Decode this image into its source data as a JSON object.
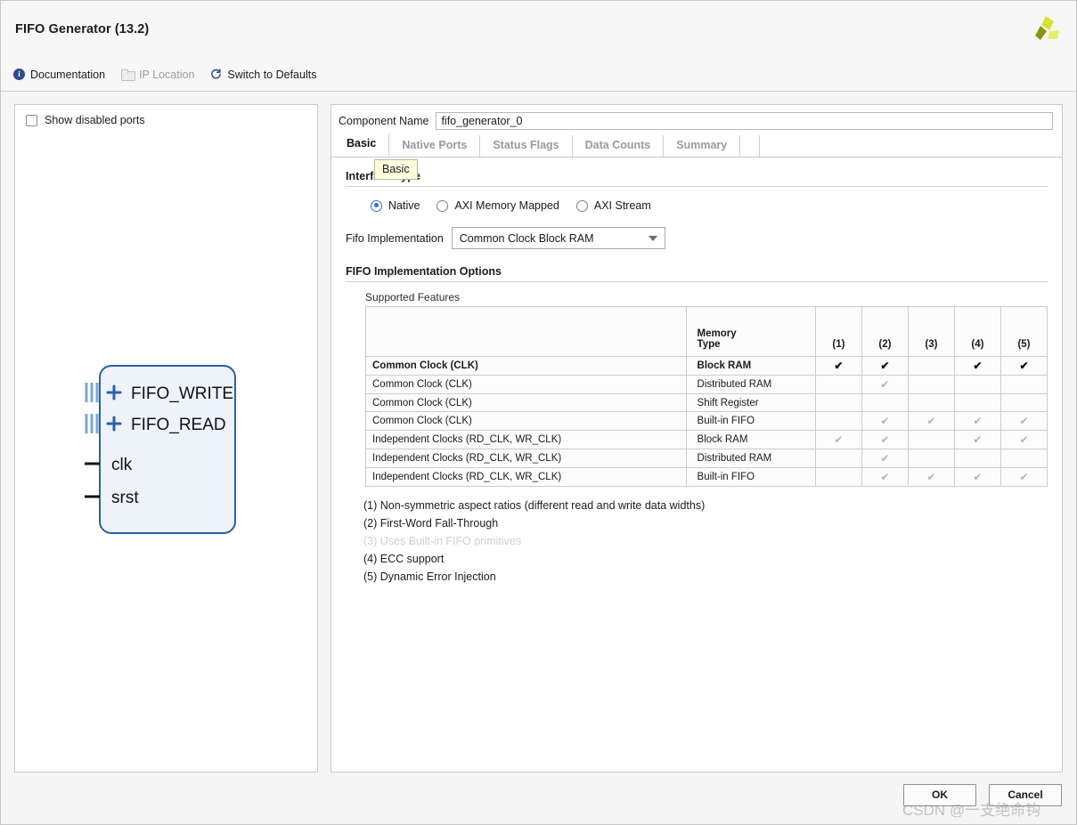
{
  "window": {
    "title": "FIFO Generator (13.2)",
    "logo_colors": {
      "light": "#d8e234",
      "mid": "#c3cf2a",
      "dark": "#8d9415"
    }
  },
  "toolbar": {
    "documentation": "Documentation",
    "ip_location": "IP Location",
    "switch_to_defaults": "Switch to Defaults",
    "accent": "#2d4b8e"
  },
  "preview": {
    "show_disabled_ports": "Show disabled ports",
    "checked": false,
    "block": {
      "bus_ports": [
        "FIFO_WRITE",
        "FIFO_READ"
      ],
      "single_ports": [
        "clk",
        "srst"
      ],
      "fill": "#eef3fa",
      "stroke": "#2c5fa8"
    }
  },
  "component": {
    "name_label": "Component Name",
    "name_value": "fifo_generator_0"
  },
  "tabs": [
    {
      "label": "Basic",
      "active": true
    },
    {
      "label": "Native Ports",
      "active": false
    },
    {
      "label": "Status Flags",
      "active": false
    },
    {
      "label": "Data Counts",
      "active": false
    },
    {
      "label": "Summary",
      "active": false
    }
  ],
  "tooltip": {
    "text": "Basic"
  },
  "basic": {
    "interface_section": "Interface Type",
    "interface_options": [
      {
        "label": "Native",
        "selected": true
      },
      {
        "label": "AXI Memory Mapped",
        "selected": false
      },
      {
        "label": "AXI Stream",
        "selected": false
      }
    ],
    "fifo_impl_label": "Fifo Implementation",
    "fifo_impl_value": "Common Clock Block RAM",
    "options_section": "FIFO Implementation Options",
    "supported_features_label": "Supported Features"
  },
  "feature_table": {
    "headers": {
      "description": "",
      "memory_type_line1": "Memory",
      "memory_type_line2": "Type",
      "numbered": [
        "(1)",
        "(2)",
        "(3)",
        "(4)",
        "(5)"
      ]
    },
    "rows": [
      {
        "clock": "Common Clock (CLK)",
        "memory": "Block RAM",
        "highlight": true,
        "marks": [
          "on",
          "on",
          "",
          "on",
          "on"
        ]
      },
      {
        "clock": "Common Clock (CLK)",
        "memory": "Distributed RAM",
        "highlight": false,
        "marks": [
          "",
          "dim",
          "",
          "",
          ""
        ]
      },
      {
        "clock": "Common Clock (CLK)",
        "memory": "Shift Register",
        "highlight": false,
        "marks": [
          "",
          "",
          "",
          "",
          ""
        ]
      },
      {
        "clock": "Common Clock (CLK)",
        "memory": "Built-in FIFO",
        "highlight": false,
        "marks": [
          "",
          "dim",
          "dim",
          "dim",
          "dim"
        ]
      },
      {
        "clock": "Independent Clocks (RD_CLK, WR_CLK)",
        "memory": "Block RAM",
        "highlight": false,
        "marks": [
          "dim",
          "dim",
          "",
          "dim",
          "dim"
        ]
      },
      {
        "clock": "Independent Clocks (RD_CLK, WR_CLK)",
        "memory": "Distributed RAM",
        "highlight": false,
        "marks": [
          "",
          "dim",
          "",
          "",
          ""
        ]
      },
      {
        "clock": "Independent Clocks (RD_CLK, WR_CLK)",
        "memory": "Built-in FIFO",
        "highlight": false,
        "marks": [
          "",
          "dim",
          "dim",
          "dim",
          "dim"
        ]
      }
    ],
    "check_glyph": "✔"
  },
  "footnotes": [
    {
      "text": "(1) Non-symmetric aspect ratios (different read and write data widths)",
      "dim": false
    },
    {
      "text": "(2) First-Word Fall-Through",
      "dim": false
    },
    {
      "text": "(3) Uses Built-in FIFO primitives",
      "dim": true
    },
    {
      "text": "(4) ECC support",
      "dim": false
    },
    {
      "text": "(5) Dynamic Error Injection",
      "dim": false
    }
  ],
  "footer": {
    "ok": "OK",
    "cancel": "Cancel"
  },
  "watermark": {
    "text": "CSDN @一支绝命钩"
  }
}
